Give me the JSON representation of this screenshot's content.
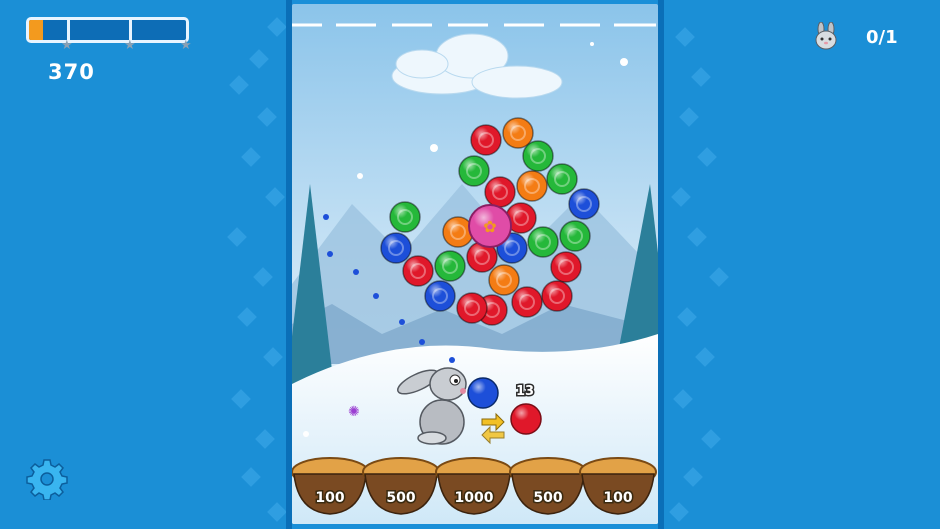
{
  "hud": {
    "score": "370",
    "progress_fraction": 0.09,
    "stars_total": 3,
    "collected_counter": "0/1",
    "collect_icon": "bunny-face-icon",
    "settings_icon": "gear-icon"
  },
  "launcher": {
    "shots_left": "13",
    "current_bubble_color": "#1d4fd9",
    "next_bubble_color": "#e0182a"
  },
  "nests": [
    {
      "label": "100"
    },
    {
      "label": "500"
    },
    {
      "label": "1000"
    },
    {
      "label": "500"
    },
    {
      "label": "100"
    }
  ],
  "bubbles": [
    {
      "color": "red"
    },
    {
      "color": "orange"
    },
    {
      "color": "green"
    },
    {
      "color": "green"
    },
    {
      "color": "red"
    },
    {
      "color": "orange"
    },
    {
      "color": "green"
    },
    {
      "color": "blue"
    },
    {
      "color": "green"
    },
    {
      "color": "orange"
    },
    {
      "color": "red"
    },
    {
      "color": "green"
    },
    {
      "color": "blue"
    },
    {
      "color": "red"
    },
    {
      "color": "green"
    },
    {
      "color": "green"
    },
    {
      "color": "blue"
    },
    {
      "color": "red"
    },
    {
      "color": "orange"
    },
    {
      "color": "red"
    },
    {
      "color": "red"
    },
    {
      "color": "red"
    },
    {
      "color": "blue"
    },
    {
      "color": "red"
    },
    {
      "color": "red"
    }
  ],
  "colors": {
    "red": "#e0182a",
    "orange": "#f47c14",
    "green": "#25b83a",
    "blue": "#1d4fd9",
    "accent": "#f39a1e"
  }
}
